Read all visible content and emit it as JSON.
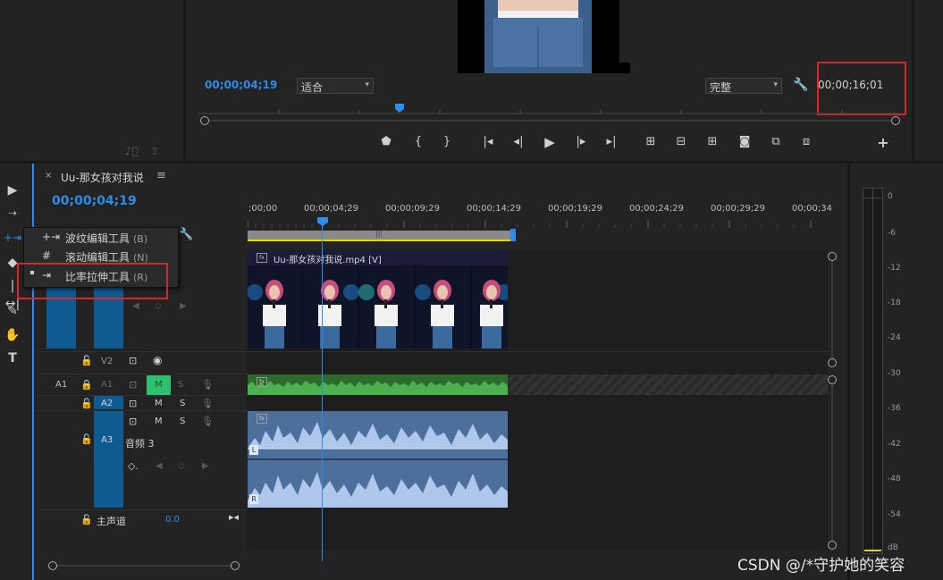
{
  "monitor": {
    "current_timecode": "00;00;04;19",
    "fit_option": "适合",
    "quality_option": "完整",
    "duration_timecode": "00;00;16;01"
  },
  "sequence": {
    "tab_title": "Uu-那女孩对我说",
    "timecode": "00;00;04;19"
  },
  "ruler": {
    "labels": [
      ";00;00",
      "00;00;04;29",
      "00;00;09;29",
      "00;00;14;29",
      "00;00;19;29",
      "00;00;24;29",
      "00;00;29;29",
      "00;00;34"
    ]
  },
  "tool_menu": {
    "items": [
      {
        "label": "波纹编辑工具",
        "shortcut": "(B)"
      },
      {
        "label": "滚动编辑工具",
        "shortcut": "(N)"
      },
      {
        "label": "比率拉伸工具",
        "shortcut": "(R)"
      }
    ]
  },
  "tracks": {
    "v2_label": "V2",
    "a1_source": "A1",
    "a1_label": "A1",
    "a2_label": "A2",
    "a3_label": "A3",
    "a3_name": "音频 3",
    "mute": "M",
    "solo": "S",
    "master_label": "主声道",
    "master_value": "0.0"
  },
  "clip": {
    "video_name": "Uu-那女孩对我说.mp4 [V]",
    "fx_badge": "fx",
    "left_channel": "L",
    "right_channel": "R"
  },
  "meter": {
    "db_labels": [
      "0",
      "-6",
      "-12",
      "-18",
      "-24",
      "-30",
      "-36",
      "-42",
      "-48",
      "-54",
      "dB"
    ]
  },
  "watermark": "CSDN @/*守护她的笑容",
  "colors": {
    "accent_blue": "#2d8ceb",
    "track_blue": "#0e5a93",
    "audio_green": "#3d8a3d",
    "audio_blue": "#5a7fb0",
    "highlight_red": "#d9262c"
  }
}
